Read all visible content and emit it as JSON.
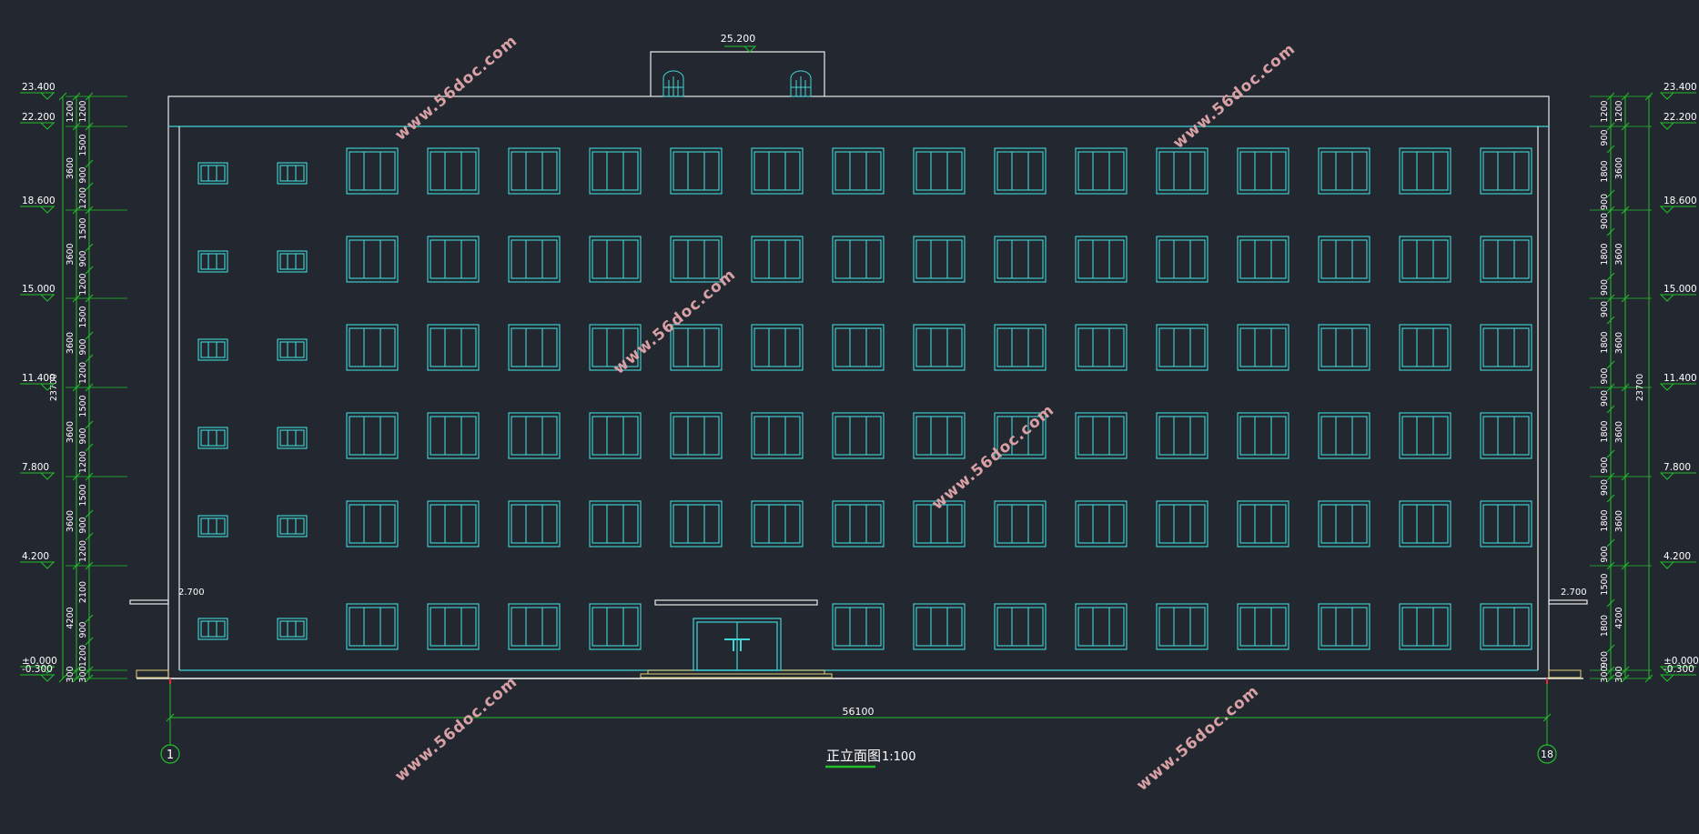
{
  "drawing": {
    "title": "正立面图",
    "scale": "1:100",
    "overall_width": "56100",
    "total_height_left": "23700",
    "total_height_right": "23700",
    "roof_top_elevation": "25.200",
    "axis_start": "1",
    "axis_end": "18",
    "canopy_left_elevation": "2.700",
    "canopy_right_elevation": "2.700",
    "watermark": "www.56doc.com"
  },
  "elevations_left": [
    "23.400",
    "22.200",
    "18.600",
    "15.000",
    "11.400",
    "7.800",
    "4.200",
    "±0.000",
    "-0.300"
  ],
  "elevations_right": [
    "23.400",
    "22.200",
    "18.600",
    "15.000",
    "11.400",
    "7.800",
    "4.200",
    "±0.000",
    "-0.300"
  ],
  "dims_left_inner": [
    "1200",
    "1500",
    "900",
    "1200",
    "1500",
    "900",
    "1200",
    "1500",
    "900",
    "1200",
    "1500",
    "900",
    "1200",
    "1500",
    "900",
    "1200",
    "2100",
    "900",
    "1200",
    "300"
  ],
  "dims_left_outer": [
    "1200",
    "3600",
    "3600",
    "3600",
    "3600",
    "3600",
    "4200",
    "300"
  ],
  "dims_right_inner": [
    "1200",
    "900",
    "1800",
    "900",
    "900",
    "1800",
    "900",
    "900",
    "1800",
    "900",
    "900",
    "1800",
    "900",
    "900",
    "1800",
    "900",
    "1500",
    "1800",
    "900",
    "300"
  ],
  "dims_right_outer": [
    "1200",
    "3600",
    "3600",
    "3600",
    "3600",
    "3600",
    "4200",
    "300"
  ],
  "colors": {
    "background": "#232830",
    "outline": "#e8e8e8",
    "window": "#3fd6d6",
    "dimension": "#22c02a",
    "text": "#ffffff",
    "watermark": "#d9a1a6",
    "step": "#e3d27a"
  }
}
